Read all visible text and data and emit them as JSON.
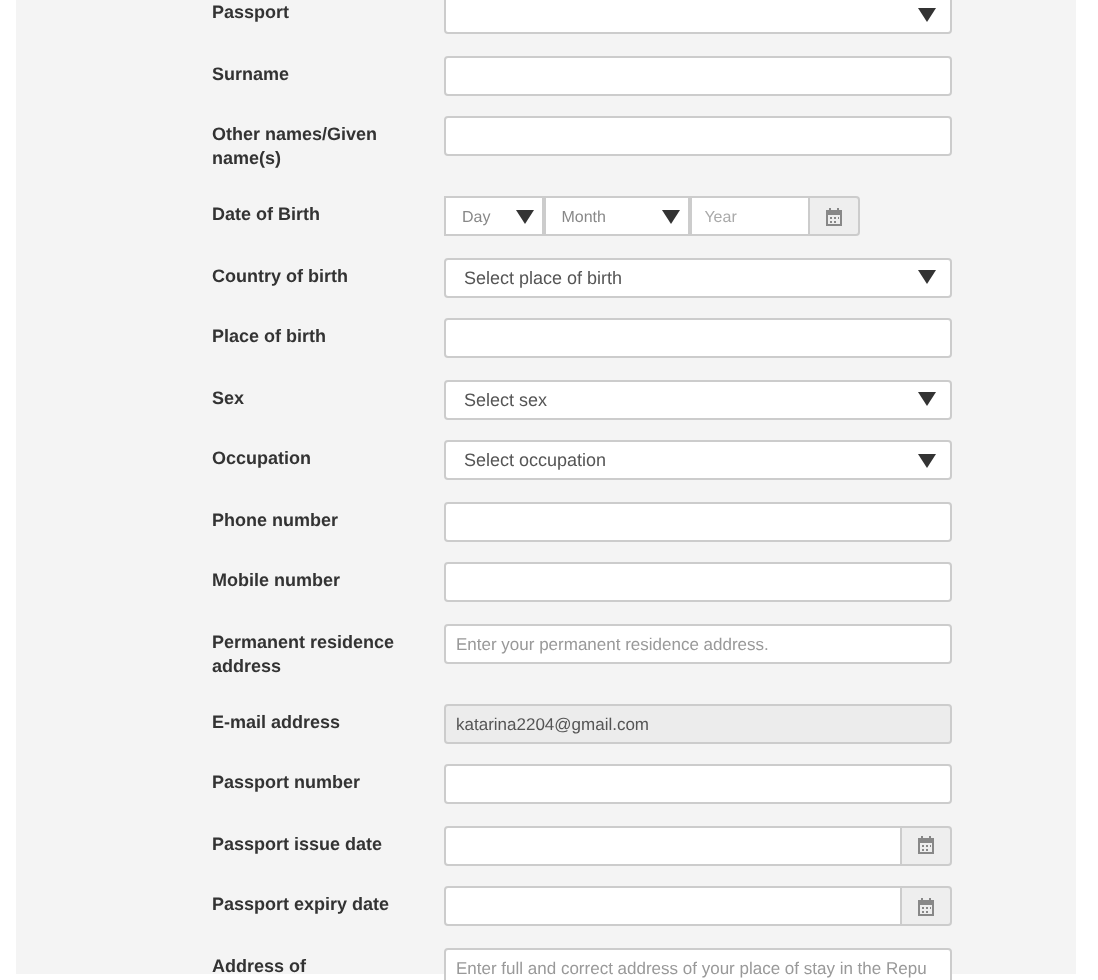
{
  "form": {
    "rows": [
      {
        "label": "Passport",
        "kind": "select",
        "value": ""
      },
      {
        "label": "Surname",
        "kind": "text",
        "value": ""
      },
      {
        "label": "Other names/Given name(s)",
        "kind": "text",
        "value": ""
      },
      {
        "label": "Date of Birth",
        "kind": "dateparts",
        "day": "Day",
        "month": "Month",
        "year_placeholder": "Year"
      },
      {
        "label": "Country of birth",
        "kind": "select",
        "value": "Select place of birth"
      },
      {
        "label": "Place of birth",
        "kind": "text",
        "value": ""
      },
      {
        "label": "Sex",
        "kind": "select",
        "value": "Select sex"
      },
      {
        "label": "Occupation",
        "kind": "select",
        "value": "Select occupation"
      },
      {
        "label": "Phone number",
        "kind": "text",
        "value": ""
      },
      {
        "label": "Mobile number",
        "kind": "text",
        "value": ""
      },
      {
        "label": "Permanent residence address",
        "kind": "text",
        "placeholder": "Enter your permanent residence address."
      },
      {
        "label": "E-mail address",
        "kind": "text",
        "value": "katarina2204@gmail.com",
        "disabled": true
      },
      {
        "label": "Passport number",
        "kind": "text",
        "value": ""
      },
      {
        "label": "Passport issue date",
        "kind": "date",
        "value": ""
      },
      {
        "label": "Passport expiry date",
        "kind": "date",
        "value": ""
      },
      {
        "label": "Address of",
        "kind": "text",
        "placeholder": "Enter full and correct address of your place of stay in the Repu"
      }
    ]
  }
}
